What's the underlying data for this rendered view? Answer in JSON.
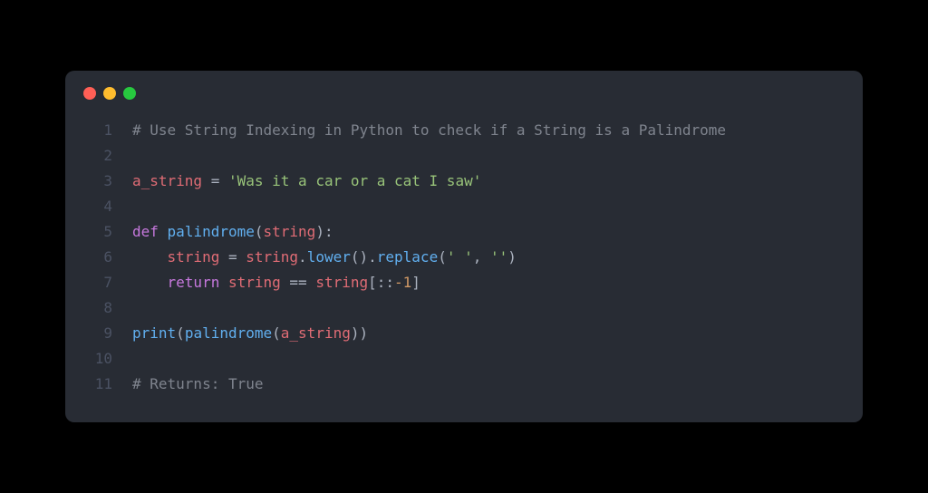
{
  "window": {
    "buttons": [
      "close",
      "minimize",
      "maximize"
    ]
  },
  "code": {
    "lines": [
      {
        "n": "1",
        "tokens": [
          {
            "t": "# Use String Indexing in Python to check if a String is a Palindrome",
            "c": "c-comment"
          }
        ]
      },
      {
        "n": "2",
        "tokens": []
      },
      {
        "n": "3",
        "tokens": [
          {
            "t": "a_string",
            "c": "c-var"
          },
          {
            "t": " ",
            "c": "c-op"
          },
          {
            "t": "=",
            "c": "c-op"
          },
          {
            "t": " ",
            "c": "c-op"
          },
          {
            "t": "'Was it a car or a cat I saw'",
            "c": "c-str"
          }
        ]
      },
      {
        "n": "4",
        "tokens": []
      },
      {
        "n": "5",
        "tokens": [
          {
            "t": "def",
            "c": "c-kw"
          },
          {
            "t": " ",
            "c": "c-op"
          },
          {
            "t": "palindrome",
            "c": "c-func"
          },
          {
            "t": "(",
            "c": "c-punc"
          },
          {
            "t": "string",
            "c": "c-param"
          },
          {
            "t": "):",
            "c": "c-punc"
          }
        ]
      },
      {
        "n": "6",
        "tokens": [
          {
            "t": "    ",
            "c": "c-op"
          },
          {
            "t": "string",
            "c": "c-var"
          },
          {
            "t": " ",
            "c": "c-op"
          },
          {
            "t": "=",
            "c": "c-op"
          },
          {
            "t": " ",
            "c": "c-op"
          },
          {
            "t": "string",
            "c": "c-var"
          },
          {
            "t": ".",
            "c": "c-punc"
          },
          {
            "t": "lower",
            "c": "c-func"
          },
          {
            "t": "().",
            "c": "c-punc"
          },
          {
            "t": "replace",
            "c": "c-func"
          },
          {
            "t": "(",
            "c": "c-punc"
          },
          {
            "t": "' '",
            "c": "c-str"
          },
          {
            "t": ", ",
            "c": "c-punc"
          },
          {
            "t": "''",
            "c": "c-str"
          },
          {
            "t": ")",
            "c": "c-punc"
          }
        ]
      },
      {
        "n": "7",
        "tokens": [
          {
            "t": "    ",
            "c": "c-op"
          },
          {
            "t": "return",
            "c": "c-kw2"
          },
          {
            "t": " ",
            "c": "c-op"
          },
          {
            "t": "string",
            "c": "c-var"
          },
          {
            "t": " ",
            "c": "c-op"
          },
          {
            "t": "==",
            "c": "c-op"
          },
          {
            "t": " ",
            "c": "c-op"
          },
          {
            "t": "string",
            "c": "c-var"
          },
          {
            "t": "[::",
            "c": "c-punc"
          },
          {
            "t": "-1",
            "c": "c-num"
          },
          {
            "t": "]",
            "c": "c-punc"
          }
        ]
      },
      {
        "n": "8",
        "tokens": []
      },
      {
        "n": "9",
        "tokens": [
          {
            "t": "print",
            "c": "c-func"
          },
          {
            "t": "(",
            "c": "c-punc"
          },
          {
            "t": "palindrome",
            "c": "c-func"
          },
          {
            "t": "(",
            "c": "c-punc"
          },
          {
            "t": "a_string",
            "c": "c-var"
          },
          {
            "t": "))",
            "c": "c-punc"
          }
        ]
      },
      {
        "n": "10",
        "tokens": []
      },
      {
        "n": "11",
        "tokens": [
          {
            "t": "# Returns: True",
            "c": "c-comment"
          }
        ]
      }
    ]
  }
}
